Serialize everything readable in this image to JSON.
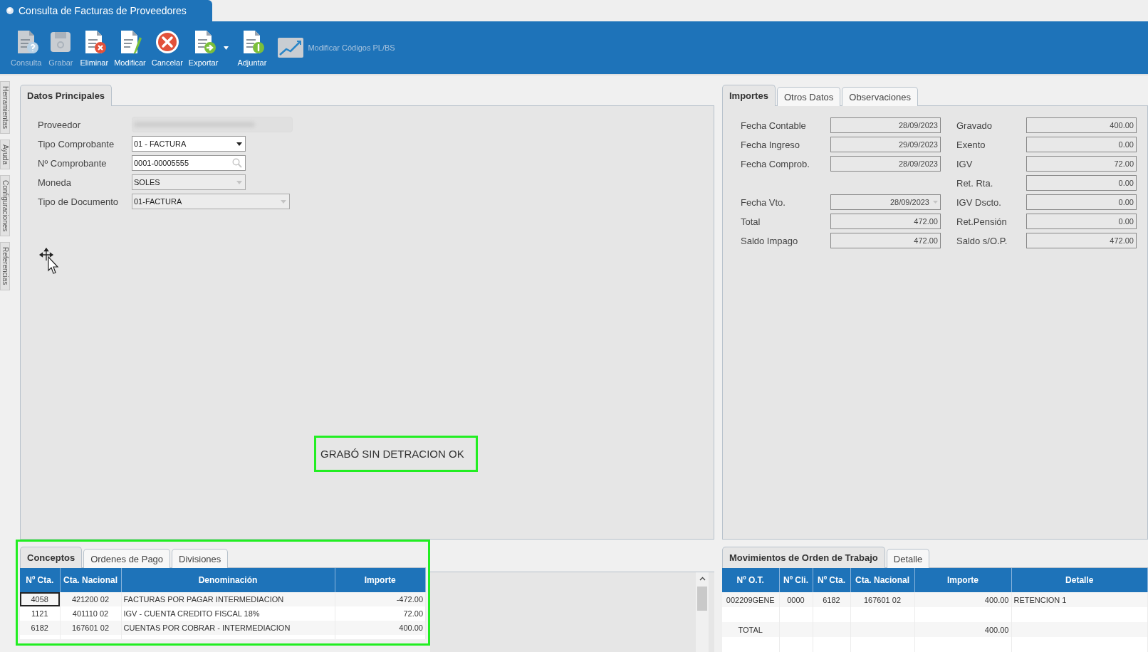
{
  "window": {
    "title": "Consulta de Facturas de Proveedores"
  },
  "toolbar": [
    {
      "label": "Consulta",
      "kind": "doc-question",
      "disabled": true,
      "dropdown": false
    },
    {
      "label": "Grabar",
      "kind": "save",
      "disabled": true,
      "dropdown": false
    },
    {
      "label": "Eliminar",
      "kind": "doc-delete",
      "disabled": false,
      "dropdown": false
    },
    {
      "label": "Modificar",
      "kind": "doc-edit",
      "disabled": false,
      "dropdown": false
    },
    {
      "label": "Cancelar",
      "kind": "cancel",
      "disabled": false,
      "dropdown": false
    },
    {
      "label": "Exportar",
      "kind": "doc-export",
      "disabled": false,
      "dropdown": true
    },
    {
      "label": "Adjuntar",
      "kind": "doc-attach",
      "disabled": false,
      "dropdown": false
    },
    {
      "label": "Modificar Códigos PL/BS",
      "kind": "chart",
      "disabled": true,
      "dropdown": false
    }
  ],
  "side_tabs": [
    "Herramientas",
    "Ayuda",
    "Configuraciones",
    "Referencias"
  ],
  "main_tabs": [
    {
      "label": "Datos Principales",
      "selected": true
    }
  ],
  "form": [
    {
      "label": "Proveedor",
      "kind": "redacted"
    },
    {
      "label": "Tipo Comprobante",
      "kind": "dropdown",
      "value": "01 - FACTURA",
      "disabled": false
    },
    {
      "label": "Nº Comprobante",
      "kind": "search",
      "value": "0001-00005555",
      "disabled": false
    },
    {
      "label": "Moneda",
      "kind": "dropdown",
      "value": "SOLES",
      "disabled": true
    },
    {
      "label": "Tipo de Documento",
      "kind": "combo",
      "value": "01-FACTURA",
      "disabled": true
    }
  ],
  "message": {
    "text": "GRABÓ SIN DETRACION OK",
    "highlighted": true
  },
  "importes_tabs": [
    {
      "label": "Importes",
      "selected": true
    },
    {
      "label": "Otros Datos",
      "selected": false
    },
    {
      "label": "Observaciones",
      "selected": false
    }
  ],
  "importes": {
    "left": [
      {
        "label": "Fecha Contable",
        "value": "28/09/2023",
        "kind": "field"
      },
      {
        "label": "Fecha Ingreso",
        "value": "29/09/2023",
        "kind": "field"
      },
      {
        "label": "Fecha Comprob.",
        "value": "28/09/2023",
        "kind": "field"
      },
      {
        "label": "Fecha Vto.",
        "value": "28/09/2023",
        "kind": "date-picker"
      },
      {
        "label": "Total",
        "value": "472.00",
        "kind": "field"
      },
      {
        "label": "Saldo Impago",
        "value": "472.00",
        "kind": "field"
      }
    ],
    "right": [
      {
        "label": "Gravado",
        "value": "400.00"
      },
      {
        "label": "Exento",
        "value": "0.00"
      },
      {
        "label": "IGV",
        "value": "72.00"
      },
      {
        "label": "Ret. Rta.",
        "value": "0.00"
      },
      {
        "label": "IGV Dscto.",
        "value": "0.00"
      },
      {
        "label": "Ret.Pensión",
        "value": "0.00"
      },
      {
        "label": "Saldo s/O.P.",
        "value": "472.00"
      }
    ]
  },
  "conceptos_tabs": [
    {
      "label": "Conceptos",
      "selected": true
    },
    {
      "label": "Ordenes de Pago",
      "selected": false
    },
    {
      "label": "Divisiones",
      "selected": false
    }
  ],
  "conceptos": {
    "highlighted": true,
    "columns": [
      {
        "label": "Nº Cta.",
        "kind": "code"
      },
      {
        "label": "Cta. Nacional",
        "kind": "code"
      },
      {
        "label": "Denominación",
        "kind": "text"
      },
      {
        "label": "Importe",
        "kind": "number"
      }
    ],
    "rows": [
      {
        "cells": [
          "4058",
          "421200 02",
          "FACTURAS POR PAGAR INTERMEDIACION",
          "-472.00"
        ],
        "focused": true
      },
      {
        "cells": [
          "1121",
          "401110 02",
          "IGV - CUENTA CREDITO FISCAL 18%",
          "72.00"
        ],
        "focused": false
      },
      {
        "cells": [
          "6182",
          "167601 02",
          "CUENTAS POR COBRAR - INTERMEDIACION",
          "400.00"
        ],
        "focused": false
      }
    ]
  },
  "movimientos_tabs": [
    {
      "label": "Movimientos de Orden de Trabajo",
      "selected": true
    },
    {
      "label": "Detalle",
      "selected": false
    }
  ],
  "movimientos": {
    "columns": [
      {
        "label": "Nº O.T.",
        "kind": "code"
      },
      {
        "label": "Nº Cli.",
        "kind": "code"
      },
      {
        "label": "Nº Cta.",
        "kind": "code"
      },
      {
        "label": "Cta. Nacional",
        "kind": "code"
      },
      {
        "label": "Importe",
        "kind": "number"
      },
      {
        "label": "Detalle",
        "kind": "text"
      }
    ],
    "rows": [
      {
        "cells": [
          "002209GENE",
          "0000",
          "6182",
          "167601 02",
          "400.00",
          "RETENCION 1"
        ]
      }
    ],
    "total": {
      "label": "TOTAL",
      "amount": "400.00"
    }
  }
}
